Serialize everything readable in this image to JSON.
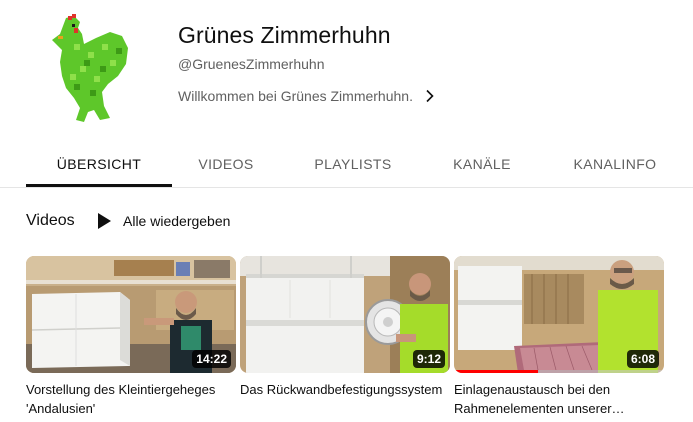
{
  "channel": {
    "name": "Grünes Zimmerhuhn",
    "handle": "@GruenesZimmerhuhn",
    "description": "Willkommen bei Grünes Zimmerhuhn.",
    "avatar_icon": "green-chicken-logo",
    "avatar_color": "#5ec72a"
  },
  "tabs": [
    {
      "label": "ÜBERSICHT",
      "active": true
    },
    {
      "label": "VIDEOS",
      "active": false
    },
    {
      "label": "PLAYLISTS",
      "active": false
    },
    {
      "label": "KANÄLE",
      "active": false
    },
    {
      "label": "KANALINFO",
      "active": false
    }
  ],
  "section": {
    "title": "Videos",
    "play_all_label": "Alle wiedergeben",
    "play_icon": "play-icon"
  },
  "videos": [
    {
      "title": "Vorstellung des Kleintiergeheges 'Andalusien'",
      "duration": "14:22",
      "watched_fraction": 0
    },
    {
      "title": "Das Rückwandbefestigungssystem",
      "duration": "9:12",
      "watched_fraction": 0
    },
    {
      "title": "Einlagenaustausch bei den Rahmenelementen unserer Kleintiergehege",
      "duration": "6:08",
      "watched_fraction": 0.4
    }
  ],
  "colors": {
    "accent_red": "#ff0000",
    "text_primary": "#0f0f0f",
    "text_secondary": "#606060"
  }
}
